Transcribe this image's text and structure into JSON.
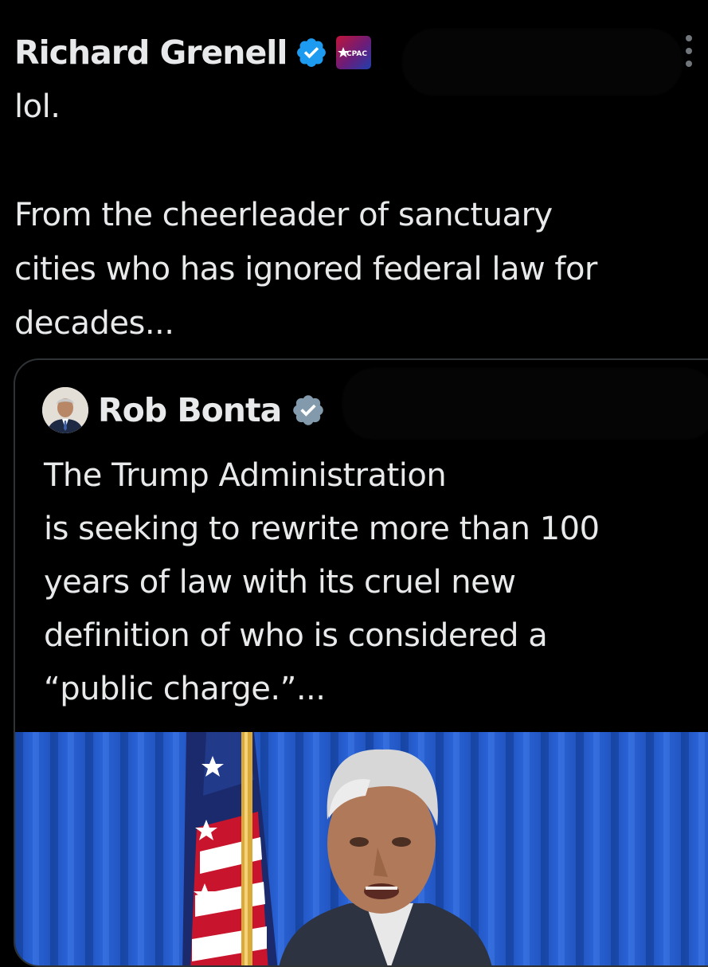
{
  "post": {
    "author_name": "Richard Grenell",
    "verified_icon": "verified-badge-icon",
    "affiliation_badge": {
      "icon": "cpac-badge-icon",
      "text": "CPAC"
    },
    "text_lines": [
      "lol.",
      "",
      "From the cheerleader of sanctuary",
      "cities who has ignored federal law for",
      "decades..."
    ],
    "menu_icon": "more-options-icon"
  },
  "quote": {
    "author_name": "Rob Bonta",
    "verified_icon": "verified-badge-gray-icon",
    "text_lines": [
      "The Trump Administration",
      "is seeking to rewrite more than 100",
      "years of law with its cruel new",
      "definition of who is considered a",
      "“public charge.”..."
    ],
    "media_icon": "photo-of-speaker-at-podium"
  },
  "colors": {
    "background": "#000000",
    "text": "#e7e9ea",
    "verified_blue": "#1d9bf0",
    "verified_gray": "#829aab",
    "border": "#2f3336"
  }
}
